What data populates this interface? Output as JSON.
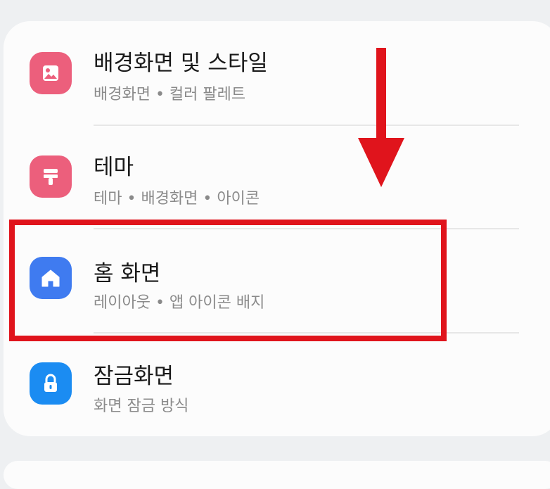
{
  "settings": {
    "items": [
      {
        "title": "배경화면 및 스타일",
        "subtitle": "배경화면 • 컬러 팔레트",
        "icon": "wallpaper-icon",
        "color": "#ec5f7c"
      },
      {
        "title": "테마",
        "subtitle": "테마 • 배경화면 • 아이콘",
        "icon": "paintbrush-icon",
        "color": "#ec5f7c"
      },
      {
        "title": "홈 화면",
        "subtitle": "레이아웃 • 앱 아이콘 배지",
        "icon": "home-icon",
        "color": "#3f7bf0"
      },
      {
        "title": "잠금화면",
        "subtitle": "화면 잠금 방식",
        "icon": "lock-icon",
        "color": "#1b8cf2"
      }
    ]
  },
  "annotation": {
    "highlight_color": "#e0141c",
    "arrow_direction": "down"
  }
}
